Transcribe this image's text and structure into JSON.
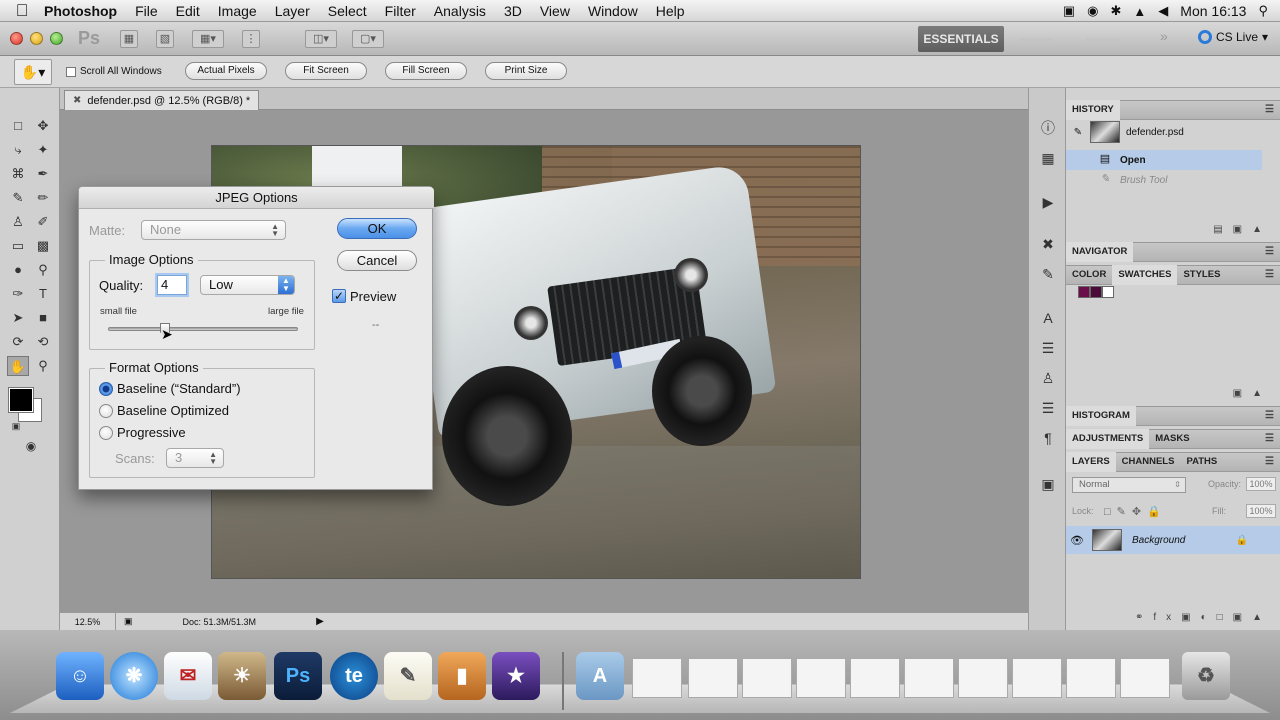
{
  "menubar": {
    "app_name": "Photoshop",
    "items": [
      "File",
      "Edit",
      "Image",
      "Layer",
      "Select",
      "Filter",
      "Analysis",
      "3D",
      "View",
      "Window",
      "Help"
    ],
    "clock": "Mon 16:13"
  },
  "appbar": {
    "workspace": "ESSENTIALS",
    "cs_live": "CS Live"
  },
  "options_bar": {
    "scroll_all_windows": "Scroll All Windows",
    "buttons": [
      "Actual Pixels",
      "Fit Screen",
      "Fill Screen",
      "Print Size"
    ]
  },
  "document": {
    "tab_title": "defender.psd @ 12.5% (RGB/8) *",
    "zoom": "12.5%",
    "doc_info": "Doc: 51.3M/51.3M"
  },
  "dialog": {
    "title": "JPEG Options",
    "matte_label": "Matte:",
    "matte_value": "None",
    "image_options_title": "Image Options",
    "quality_label": "Quality:",
    "quality_value": "4",
    "quality_preset": "Low",
    "small_file": "small file",
    "large_file": "large file",
    "quality_slider_fraction": 0.3,
    "format_options_title": "Format Options",
    "format_options": [
      "Baseline (“Standard”)",
      "Baseline Optimized",
      "Progressive"
    ],
    "selected_format": 0,
    "scans_label": "Scans:",
    "scans_value": "3",
    "ok": "OK",
    "cancel": "Cancel",
    "preview_label": "Preview",
    "preview_checked": true,
    "file_size": "--"
  },
  "panels": {
    "history_title": "HISTORY",
    "history_snapshot": "defender.psd",
    "history_items": [
      "Open",
      "Brush Tool"
    ],
    "navigator_title": "NAVIGATOR",
    "color_tabs": [
      "COLOR",
      "SWATCHES",
      "STYLES"
    ],
    "swatches": [
      "#6a0f4a",
      "#4a0a3a",
      "#ffffff"
    ],
    "histogram_title": "HISTOGRAM",
    "adjust_tabs": [
      "ADJUSTMENTS",
      "MASKS"
    ],
    "layer_tabs": [
      "LAYERS",
      "CHANNELS",
      "PATHS"
    ],
    "blend_mode": "Normal",
    "opacity_label": "Opacity:",
    "opacity_value": "100%",
    "lock_label": "Lock:",
    "fill_label": "Fill:",
    "fill_value": "100%",
    "layer_name": "Background"
  }
}
